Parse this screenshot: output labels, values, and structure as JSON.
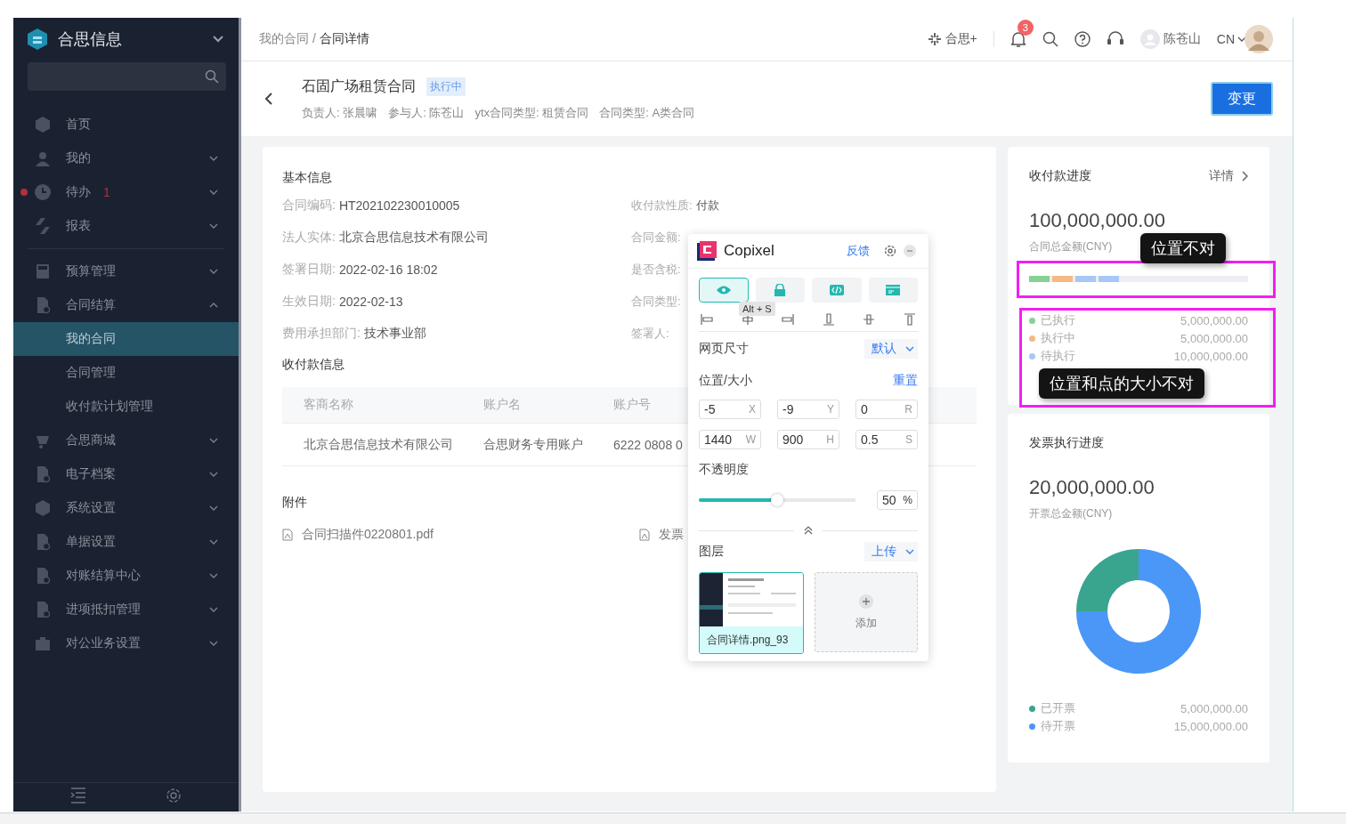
{
  "sidebar": {
    "title": "合思信息",
    "items": [
      {
        "label": "首页",
        "selected": false
      },
      {
        "label": "我的",
        "selected": false,
        "expanded": false
      },
      {
        "label": "待办",
        "selected": false,
        "expanded": false,
        "badge": "1"
      },
      {
        "label": "报表",
        "selected": false,
        "expanded": false
      },
      {
        "label": "预算管理",
        "selected": false,
        "expanded": false
      },
      {
        "label": "合同结算",
        "selected": false,
        "expanded": true,
        "children": [
          {
            "label": "我的合同",
            "selected": true
          },
          {
            "label": "合同管理",
            "selected": false
          },
          {
            "label": "收付款计划管理",
            "selected": false
          }
        ]
      },
      {
        "label": "合思商城",
        "selected": false,
        "expanded": false
      },
      {
        "label": "电子档案",
        "selected": false,
        "expanded": false
      },
      {
        "label": "系统设置",
        "selected": false,
        "expanded": false
      },
      {
        "label": "单据设置",
        "selected": false,
        "expanded": false
      },
      {
        "label": "对账结算中心",
        "selected": false,
        "expanded": false
      },
      {
        "label": "进项抵扣管理",
        "selected": false,
        "expanded": false
      },
      {
        "label": "对公业务设置",
        "selected": false,
        "expanded": false
      }
    ]
  },
  "topbar": {
    "breadcrumb": [
      "我的合同",
      "合同详情"
    ],
    "separator": "/",
    "apps_label": "合思+",
    "notifications": "3",
    "user": "陈苍山",
    "language": "CN"
  },
  "header": {
    "title": "石固广场租赁合同",
    "status": "执行中",
    "meta": [
      "负责人: 张晨啸",
      "参与人: 陈苍山",
      "ytx合同类型: 租赁合同",
      "合同类型: A类合同"
    ],
    "action": "变更"
  },
  "basic_info": {
    "title": "基本信息",
    "fields": [
      {
        "label": "合同编码:",
        "value": "HT202102230010005"
      },
      {
        "label": "法人实体:",
        "value": "北京合思信息技术有限公司"
      },
      {
        "label": "签署日期:",
        "value": "2022-02-16 18:02"
      },
      {
        "label": "生效日期:",
        "value": "2022-02-13"
      },
      {
        "label": "费用承担部门:",
        "value": "技术事业部"
      }
    ],
    "fields_right": [
      {
        "label": "收付款性质:",
        "value": "付款"
      },
      {
        "label": "合同金额:"
      },
      {
        "label": "是否含税:"
      },
      {
        "label": "合同类型:"
      },
      {
        "label": "签署人:"
      }
    ]
  },
  "payment": {
    "title": "收付款信息",
    "columns": [
      "客商名称",
      "账户名",
      "账户号"
    ],
    "rows": [
      [
        "北京合思信息技术有限公司",
        "合思财务专用账户",
        "6222 0808 0"
      ]
    ]
  },
  "attachments": {
    "title": "附件",
    "files": [
      "合同扫描件0220801.pdf",
      "发票"
    ]
  },
  "receipt": {
    "title": "收付款进度",
    "link": "详情",
    "amount": "100,000,000.00",
    "amount_label": "合同总金额(CNY)",
    "segments": [
      {
        "color": "#86d293"
      },
      {
        "color": "#f6b884"
      },
      {
        "color": "#a7c8f5"
      },
      {
        "color": "#a7c8f5"
      }
    ],
    "legend": [
      {
        "label": "已执行",
        "value": "5,000,000.00",
        "color": "#86d293"
      },
      {
        "label": "执行中",
        "value": "5,000,000.00",
        "color": "#f6b884"
      },
      {
        "label": "待执行",
        "value": "10,000,000.00",
        "color": "#a7c8f5"
      }
    ]
  },
  "invoice": {
    "title": "发票执行进度",
    "amount": "20,000,000.00",
    "amount_label": "开票总金额(CNY)",
    "chart_data": {
      "type": "donut",
      "categories": [
        "已开票",
        "待开票"
      ],
      "values": [
        25,
        75
      ]
    },
    "legend": [
      {
        "value": "5,000,000.00",
        "color": "#3aa58f"
      },
      {
        "value": "15,000,000.00",
        "color": "#4a97f7"
      }
    ]
  },
  "annotations": [
    "位置不对",
    "位置和点的大小不对"
  ],
  "copixel": {
    "name": "Copixel",
    "feedback": "反馈",
    "tools": [
      {
        "selected": true
      },
      {
        "selected": false
      },
      {
        "selected": false
      },
      {
        "selected": false
      }
    ],
    "tooltip": "Alt + S",
    "page_size": {
      "label": "网页尺寸",
      "value": "默认"
    },
    "position": {
      "label": "位置/大小",
      "reset": "重置",
      "fields": [
        {
          "value": "-5",
          "unit": "X"
        },
        {
          "value": "-9",
          "unit": "Y"
        },
        {
          "value": "0",
          "unit": "R"
        },
        {
          "value": "1440",
          "unit": "W"
        },
        {
          "value": "900",
          "unit": "H"
        },
        {
          "value": "0.5",
          "unit": "S"
        }
      ]
    },
    "opacity": {
      "label": "不透明度",
      "level": 0.5,
      "value": "50",
      "unit": "%"
    },
    "layers": {
      "label": "图层",
      "upload": "上传",
      "items": [
        {
          "name": "合同详情.png_93",
          "selected": true
        }
      ],
      "add": "添加"
    }
  }
}
